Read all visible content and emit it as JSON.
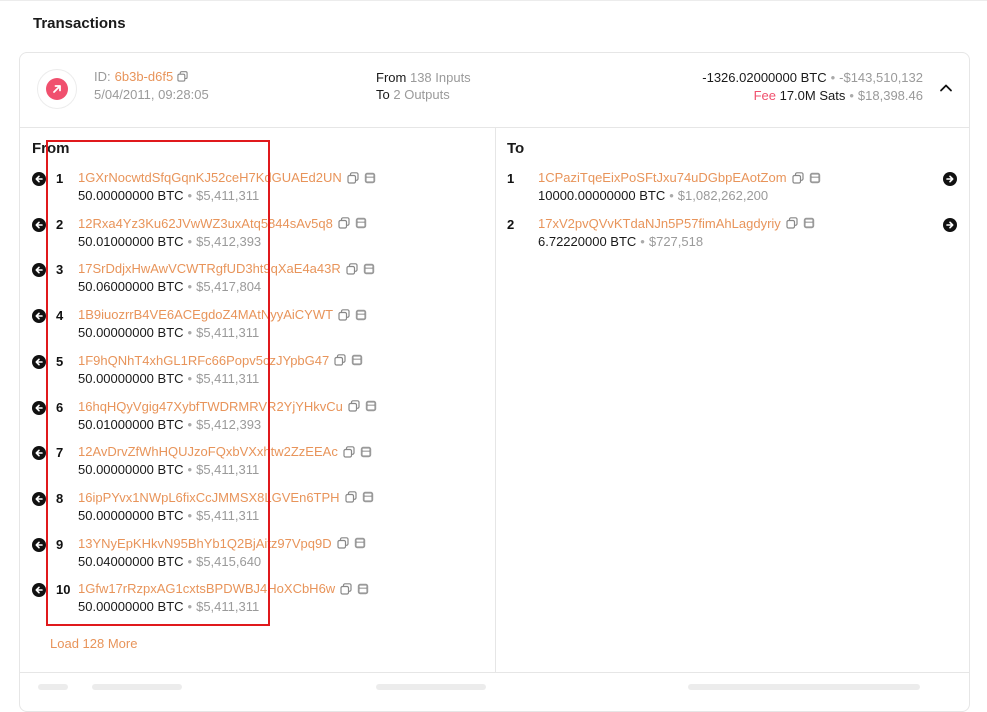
{
  "page": {
    "title": "Transactions"
  },
  "transaction": {
    "id_label": "ID:",
    "id": "6b3b-d6f5",
    "date": "5/04/2011, 09:28:05",
    "from_label": "From",
    "from_value": "138 Inputs",
    "to_label": "To",
    "to_value": "2 Outputs",
    "amount": "-1326.02000000 BTC",
    "amount_usd": "-$143,510,132",
    "fee_label": "Fee",
    "fee_value": "17.0M Sats",
    "fee_usd": "$18,398.46",
    "direction_icon": "arrow-up-right-icon",
    "collapse_icon": "chevron-up-icon"
  },
  "inputs": {
    "title": "From",
    "items": [
      {
        "index": "1",
        "address": "1GXrNocwtdSfqGqnKJ52ceH7KdGUAEd2UN",
        "btc": "50.00000000 BTC",
        "usd": "$5,411,311"
      },
      {
        "index": "2",
        "address": "12Rxa4Yz3Ku62JVwWZ3uxAtq5844sAv5q8",
        "btc": "50.01000000 BTC",
        "usd": "$5,412,393"
      },
      {
        "index": "3",
        "address": "17SrDdjxHwAwVCWTRgfUD3ht9qXaE4a43R",
        "btc": "50.06000000 BTC",
        "usd": "$5,417,804"
      },
      {
        "index": "4",
        "address": "1B9iuozrrB4VE6ACEgdoZ4MAtNyyAiCYWT",
        "btc": "50.00000000 BTC",
        "usd": "$5,411,311"
      },
      {
        "index": "5",
        "address": "1F9hQNhT4xhGL1RFc66Popv5czJYpbG47",
        "btc": "50.00000000 BTC",
        "usd": "$5,411,311"
      },
      {
        "index": "6",
        "address": "16hqHQyVgig47XybfTWDRMRVR2YjYHkvCu",
        "btc": "50.01000000 BTC",
        "usd": "$5,412,393"
      },
      {
        "index": "7",
        "address": "12AvDrvZfWhHQUJzoFQxbVXxhtw2ZzEEAc",
        "btc": "50.00000000 BTC",
        "usd": "$5,411,311"
      },
      {
        "index": "8",
        "address": "16ipPYvx1NWpL6fixCcJMMSX8LGVEn6TPH",
        "btc": "50.00000000 BTC",
        "usd": "$5,411,311"
      },
      {
        "index": "9",
        "address": "13YNyEpKHkvN95BhYb1Q2BjAitz97Vpq9D",
        "btc": "50.04000000 BTC",
        "usd": "$5,415,640"
      },
      {
        "index": "10",
        "address": "1Gfw17rRzpxAG1cxtsBPDWBJ4HoXCbH6w",
        "btc": "50.00000000 BTC",
        "usd": "$5,411,311"
      }
    ],
    "load_more": "Load 128 More"
  },
  "outputs": {
    "title": "To",
    "items": [
      {
        "index": "1",
        "address": "1CPaziTqeEixPoSFtJxu74uDGbpEAotZom",
        "btc": "10000.00000000 BTC",
        "usd": "$1,082,262,200"
      },
      {
        "index": "2",
        "address": "17xV2pvQVvKTdaNJn5P57fimAhLagdyriy",
        "btc": "6.72220000 BTC",
        "usd": "$727,518"
      }
    ]
  },
  "colors": {
    "accent": "#e8945a",
    "fee": "#f0506e",
    "highlight": "#e0191c"
  }
}
